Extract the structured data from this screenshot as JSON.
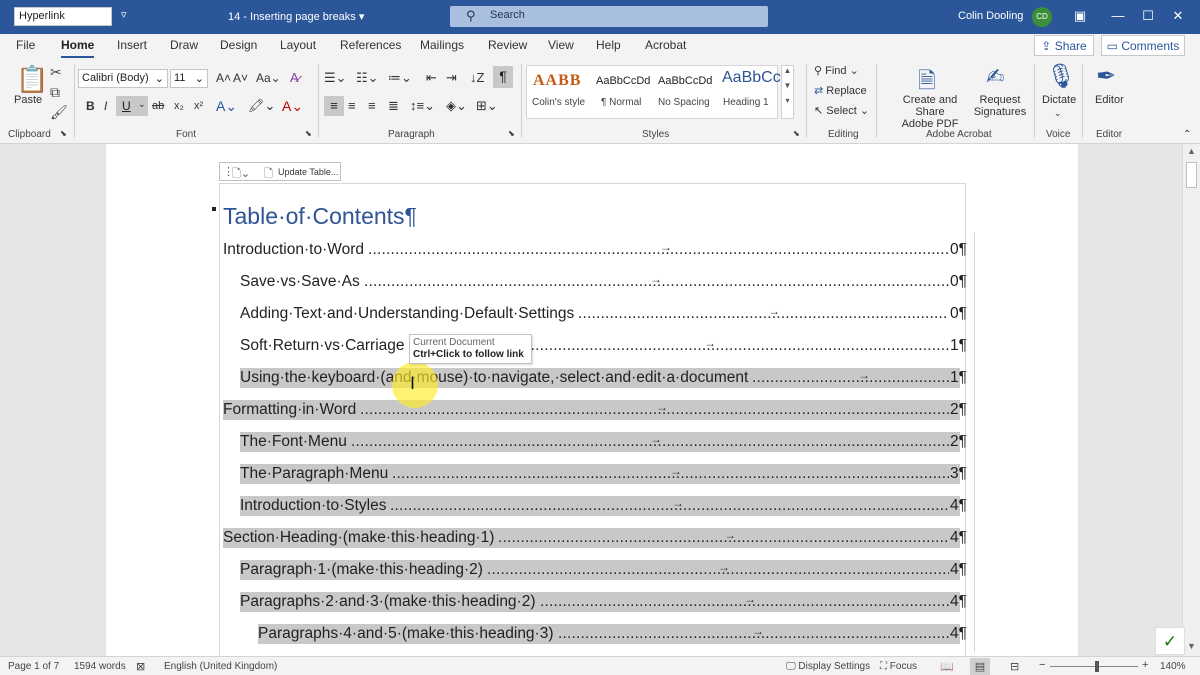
{
  "titlebar": {
    "style_box": "Hyperlink",
    "qa_dropdown": "▿",
    "doc_title": "14 - Inserting page breaks",
    "doc_title_caret": "▾",
    "search_placeholder": "Search",
    "user_name": "Colin Dooling",
    "avatar_initials": "CD",
    "accent": "#2b579a"
  },
  "tabs": [
    "File",
    "Home",
    "Insert",
    "Draw",
    "Design",
    "Layout",
    "References",
    "Mailings",
    "Review",
    "View",
    "Help",
    "Acrobat"
  ],
  "active_tab": "Home",
  "share_label": "Share",
  "comments_label": "Comments",
  "ribbon": {
    "paste_label": "Paste",
    "font_name": "Calibri (Body)",
    "font_size": "11",
    "groups": {
      "clipboard": "Clipboard",
      "font": "Font",
      "paragraph": "Paragraph",
      "styles": "Styles",
      "editing": "Editing",
      "adobe": "Adobe Acrobat",
      "voice": "Voice",
      "editor": "Editor"
    },
    "styles": [
      {
        "sample": "AABB",
        "name": "Colin's style"
      },
      {
        "sample": "AaBbCcDd",
        "name": "¶ Normal"
      },
      {
        "sample": "AaBbCcDd",
        "name": "No Spacing"
      },
      {
        "sample": "AaBbCc",
        "name": "Heading 1"
      }
    ],
    "find_label": "Find",
    "replace_label": "Replace",
    "select_label": "Select",
    "create_share_1": "Create and Share",
    "create_share_2": "Adobe PDF",
    "request_1": "Request",
    "request_2": "Signatures",
    "dictate_label": "Dictate",
    "editor_label": "Editor"
  },
  "document": {
    "toc_toolbar_label": "Update Table...",
    "toc_heading": "Table·of·Contents¶",
    "tooltip_line1": "Current Document",
    "tooltip_line2": "Ctrl+Click to follow link",
    "entries": [
      {
        "text": "Introduction·to·Word",
        "page": "0¶",
        "level": 1,
        "highlight": false
      },
      {
        "text": "Save·vs·Save·As",
        "page": "0¶",
        "level": 2,
        "highlight": false
      },
      {
        "text": "Adding·Text·and·Understanding·Default·Settings",
        "page": "0¶",
        "level": 2,
        "highlight": false
      },
      {
        "text": "Soft·Return·vs·Carriage",
        "page": "1¶",
        "level": 2,
        "highlight": false
      },
      {
        "text": "Using·the·keyboard·(and·mouse)·to·navigate,·select·and·edit·a·document",
        "page": "1¶",
        "level": 2,
        "highlight": true
      },
      {
        "text": "Formatting·in·Word",
        "page": "2¶",
        "level": 1,
        "highlight": true
      },
      {
        "text": "The·Font·Menu",
        "page": "2¶",
        "level": 2,
        "highlight": true
      },
      {
        "text": "The·Paragraph·Menu",
        "page": "3¶",
        "level": 2,
        "highlight": true
      },
      {
        "text": "Introduction·to·Styles",
        "page": "4¶",
        "level": 2,
        "highlight": true
      },
      {
        "text": "Section·Heading·(make·this·heading·1)",
        "page": "4¶",
        "level": 1,
        "highlight": true
      },
      {
        "text": "Paragraph·1·(make·this·heading·2)",
        "page": "4¶",
        "level": 2,
        "highlight": true
      },
      {
        "text": "Paragraphs·2·and·3·(make·this·heading·2)",
        "page": "4¶",
        "level": 2,
        "highlight": true
      },
      {
        "text": "Paragraphs·4·and·5·(make·this·heading·3)",
        "page": "4¶",
        "level": 3,
        "highlight": true
      }
    ]
  },
  "statusbar": {
    "page": "Page 1 of 7",
    "words": "1594 words",
    "language": "English (United Kingdom)",
    "display_settings": "Display Settings",
    "focus": "Focus",
    "zoom": "140%"
  }
}
